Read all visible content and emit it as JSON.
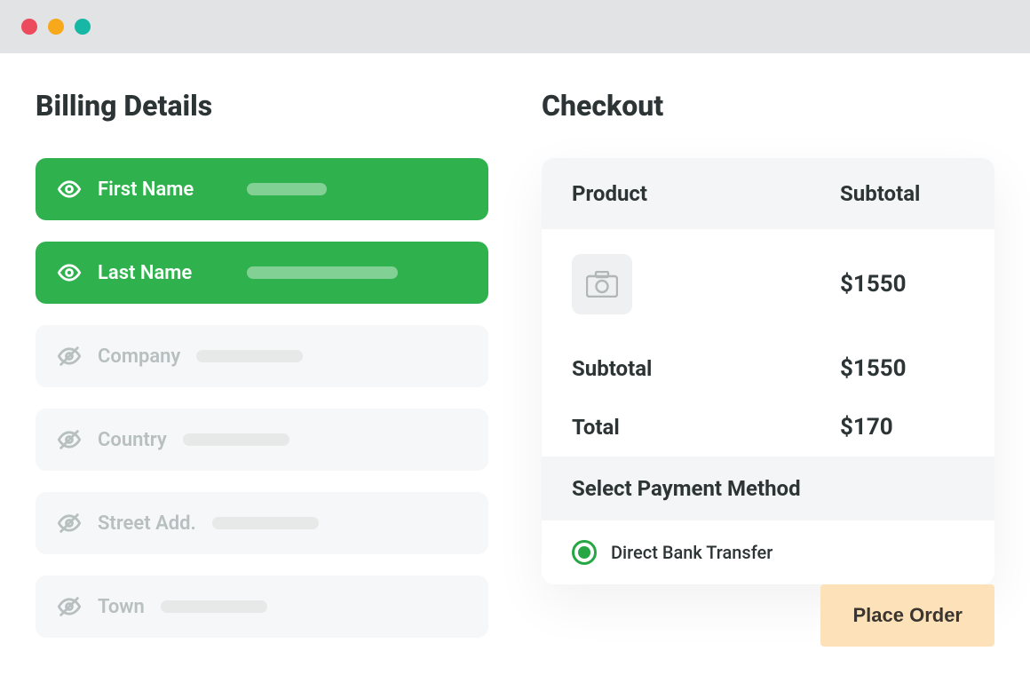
{
  "billing": {
    "title": "Billing Details",
    "fields": [
      {
        "label": "First Name",
        "visible": true
      },
      {
        "label": "Last Name",
        "visible": true
      },
      {
        "label": "Company",
        "visible": false
      },
      {
        "label": "Country",
        "visible": false
      },
      {
        "label": "Street Add.",
        "visible": false
      },
      {
        "label": "Town",
        "visible": false
      }
    ]
  },
  "checkout": {
    "title": "Checkout",
    "cols": {
      "product": "Product",
      "subtotal": "Subtotal"
    },
    "line_price": "$1550",
    "summary": [
      {
        "label": "Subtotal",
        "value": "$1550"
      },
      {
        "label": "Total",
        "value": "$170"
      }
    ],
    "payment_title": "Select Payment Method",
    "payment_option": "Direct Bank Transfer",
    "cta": "Place Order"
  }
}
